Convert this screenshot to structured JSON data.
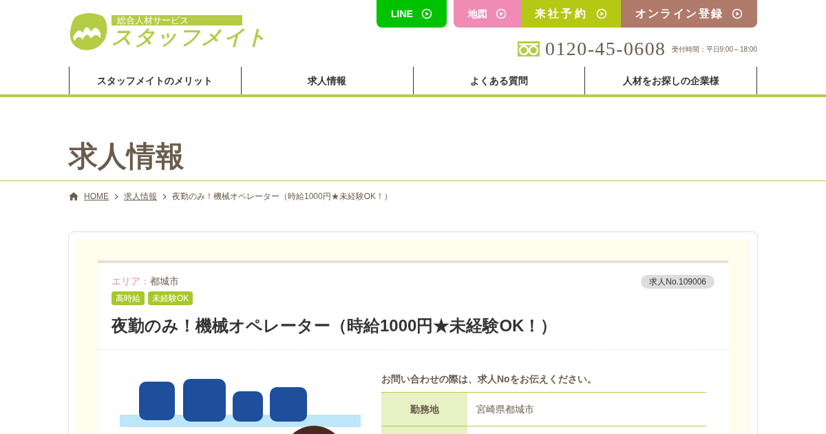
{
  "header": {
    "logo": {
      "tagline": "総合人材サービス",
      "name": "スタッフメイト"
    },
    "buttons": [
      {
        "label": "LINE",
        "kind": "line"
      },
      {
        "label": "地図",
        "kind": "map"
      },
      {
        "label": "来社予約",
        "kind": "visit"
      },
      {
        "label": "オンライン登録",
        "kind": "online"
      }
    ],
    "phone": {
      "number": "0120-45-0608",
      "hours": "受付時間：平日9:00～18:00"
    }
  },
  "nav": [
    "スタッフメイトのメリット",
    "求人情報",
    "よくある質問",
    "人材をお探しの企業様"
  ],
  "page_title": "求人情報",
  "breadcrumb": [
    {
      "label": "HOME",
      "link": true
    },
    {
      "label": "求人情報",
      "link": true
    },
    {
      "label": "夜勤のみ！機械オペレーター（時給1000円★未経験OK！）",
      "link": false
    }
  ],
  "job": {
    "area_label": "エリア：",
    "area": "都城市",
    "job_no": "求人No.109006",
    "tags": [
      "高時給",
      "未経験OK"
    ],
    "title": "夜勤のみ！機械オペレーター（時給1000円★未経験OK！）",
    "image": {
      "kind": "picture"
    },
    "notice": "お問い合わせの際は、求人Noをお伝えください。",
    "details": [
      {
        "label": "勤務地",
        "value": "宮崎県都城市"
      }
    ]
  }
}
